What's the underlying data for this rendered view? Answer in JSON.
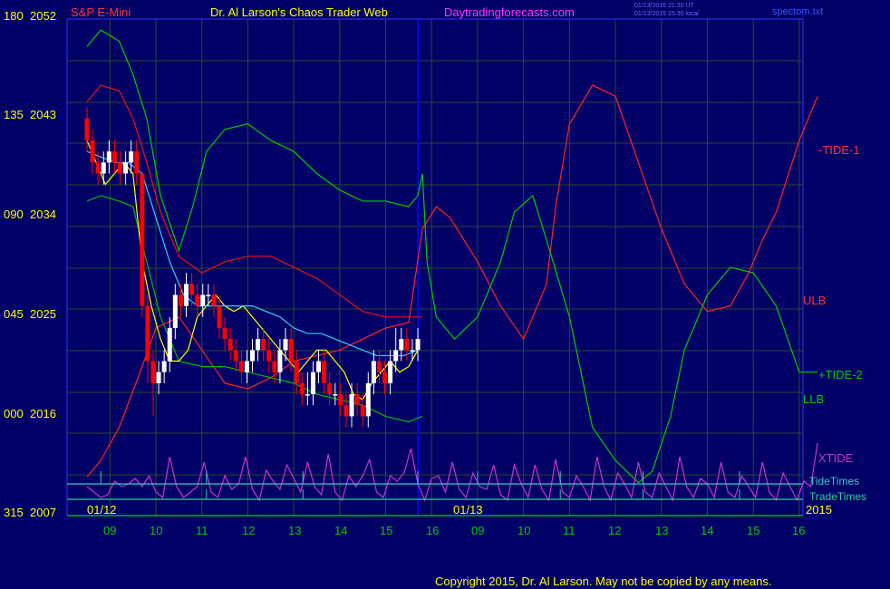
{
  "header": {
    "symbol": "S&P E-Mini",
    "title": "Dr. Al Larson's Chaos Trader Web",
    "site": "Daytradingforecasts.com",
    "timestamp_1": "01/13/2015 21:30 UT",
    "timestamp_2": "01/13/2015 15:30 local",
    "file": "spectom.txt"
  },
  "footer": {
    "copyright": "Copyright 2015, Dr. Al Larson. May not be copied by any means."
  },
  "colors": {
    "background": "#000066",
    "grid": "#2a4a2a",
    "vline": "#0000ff",
    "tide1": "#ff0000",
    "ulb": "#ff0000",
    "tide2": "#00cc00",
    "llb": "#00cc00",
    "xtide": "#cc33cc",
    "tidetimes": "#33cccc",
    "tradetimes": "#33cc99",
    "price_up": "#ffffff",
    "price_down": "#ff0000",
    "ma_fast": "#ffff00",
    "ma_slow": "#33ccff",
    "axis_text": "#ffff00",
    "time_text": "#00cc00"
  },
  "chart_data": {
    "type": "line",
    "y_axis": {
      "left_labels": [
        "180",
        "135",
        "090",
        "045",
        "000",
        "315"
      ],
      "right_labels": [
        "2052",
        "2043",
        "2034",
        "2025",
        "2016",
        "2007"
      ],
      "ylim": [
        2007,
        2052
      ]
    },
    "x_axis": {
      "hours": [
        "09",
        "10",
        "11",
        "12",
        "13",
        "14",
        "15",
        "16",
        "09",
        "10",
        "11",
        "12",
        "13",
        "14",
        "15",
        "16"
      ],
      "dates": [
        "01/12",
        "01/13"
      ],
      "year": "2015"
    },
    "legend": [
      {
        "name": "-TIDE-1",
        "color": "#ff3333"
      },
      {
        "name": "ULB",
        "color": "#ff3333"
      },
      {
        "name": "+TIDE-2",
        "color": "#00cc00"
      },
      {
        "name": "LLB",
        "color": "#00cc00"
      },
      {
        "name": "XTIDE",
        "color": "#cc33cc"
      },
      {
        "name": "TideTimes",
        "color": "#33cccc"
      },
      {
        "name": "TradeTimes",
        "color": "#33cc99"
      }
    ],
    "series": [
      {
        "key": "tide1",
        "x": [
          0,
          0.3,
          0.7,
          1.2,
          1.5,
          2,
          2.5,
          3,
          3.5,
          4,
          4.5,
          5,
          5.5,
          6,
          6.5,
          7,
          7.3,
          7.6,
          7.9,
          8.2,
          8.5,
          9,
          9.5,
          10,
          10.2,
          10.5,
          11,
          11.5,
          12,
          12.5,
          13,
          13.5,
          14,
          14.4,
          14.7,
          15,
          15.5,
          15.9
        ],
        "values": [
          2010.5,
          2012,
          2015,
          2020.5,
          2024,
          2025,
          2022,
          2019,
          2018.5,
          2019.5,
          2021,
          2021.5,
          2022,
          2023,
          2024,
          2024.5,
          2033,
          2035,
          2034,
          2032,
          2030,
          2026,
          2023,
          2028,
          2035,
          2042.5,
          2046,
          2045,
          2039,
          2033,
          2028,
          2025.5,
          2026,
          2029,
          2032,
          2034.5,
          2041,
          2045
        ]
      },
      {
        "key": "ulb",
        "x": [
          0,
          0.3,
          0.7,
          1,
          1.3,
          1.6,
          2,
          2.5,
          3,
          3.5,
          4,
          4.5,
          5,
          5.5,
          6,
          6.5,
          7,
          7.3
        ],
        "values": [
          2044.5,
          2046,
          2045.5,
          2043,
          2039,
          2034.5,
          2030.5,
          2029,
          2030,
          2030.5,
          2030.5,
          2029.5,
          2028.5,
          2027,
          2025.5,
          2025,
          2025,
          2025
        ]
      },
      {
        "key": "tide2",
        "x": [
          0,
          0.3,
          0.7,
          1,
          1.3,
          1.6,
          2,
          2.3,
          2.6,
          3,
          3.5,
          4,
          4.5,
          5,
          5.5,
          6,
          6.5,
          7,
          7.2,
          7.3,
          7.4,
          7.6,
          8,
          8.5,
          9,
          9.3,
          9.7,
          10,
          10.5,
          11,
          11.5,
          12,
          12.3,
          12.7,
          13,
          13.5,
          14,
          14.5,
          15,
          15.5,
          15.9
        ],
        "values": [
          2049.5,
          2051,
          2050,
          2047,
          2043,
          2036,
          2031,
          2035,
          2040,
          2042,
          2042.5,
          2041,
          2040,
          2038,
          2036.5,
          2035.5,
          2035.5,
          2035,
          2036,
          2038,
          2030,
          2025,
          2023,
          2025,
          2030,
          2034.5,
          2036,
          2032,
          2025,
          2015,
          2012,
          2010,
          2011,
          2016,
          2022,
          2027,
          2029.5,
          2029,
          2026,
          2020,
          2020
        ]
      },
      {
        "key": "llb",
        "x": [
          0,
          0.3,
          0.7,
          1,
          1.3,
          1.6,
          2,
          2.5,
          3,
          3.5,
          4,
          4.5,
          5,
          5.5,
          6,
          6.5,
          7,
          7.3
        ],
        "values": [
          2035.5,
          2036,
          2035.5,
          2035,
          2030,
          2025,
          2021,
          2020.5,
          2020.5,
          2020,
          2019.5,
          2019,
          2018,
          2017.5,
          2017,
          2016,
          2015.5,
          2016
        ]
      },
      {
        "key": "ma_fast",
        "x": [
          0,
          0.2,
          0.4,
          0.6,
          0.8,
          1,
          1.2,
          1.4,
          1.6,
          1.8,
          2,
          2.2,
          2.4,
          2.6,
          2.8,
          3,
          3.2,
          3.4,
          3.6,
          3.8,
          4,
          4.2,
          4.4,
          4.6,
          4.8,
          5,
          5.2,
          5.4,
          5.6,
          5.8,
          6,
          6.2,
          6.4,
          6.6,
          6.8,
          7,
          7.2
        ],
        "values": [
          2041,
          2039,
          2037,
          2038,
          2039,
          2038,
          2030,
          2026,
          2023,
          2021,
          2021,
          2022,
          2025,
          2026,
          2027,
          2026,
          2025.5,
          2026,
          2025,
          2024,
          2023,
          2022,
          2021,
          2020,
          2021,
          2022,
          2022,
          2021,
          2020,
          2018,
          2017.5,
          2019,
          2020,
          2021,
          2020,
          2020.5,
          2022
        ]
      },
      {
        "key": "ma_slow",
        "x": [
          0,
          0.3,
          0.6,
          0.9,
          1.2,
          1.5,
          1.8,
          2.1,
          2.4,
          2.7,
          3,
          3.3,
          3.6,
          3.9,
          4.2,
          4.5,
          4.8,
          5.1,
          5.4,
          5.7,
          6,
          6.3,
          6.6,
          6.9,
          7.2
        ],
        "values": [
          2040,
          2039.5,
          2039,
          2039,
          2038,
          2034,
          2030,
          2027,
          2026,
          2026,
          2026,
          2026,
          2026,
          2025.5,
          2025,
          2024,
          2023.5,
          2023.5,
          2023,
          2022.5,
          2022,
          2021.5,
          2021.5,
          2021.5,
          2022
        ]
      },
      {
        "key": "xtide",
        "x": [
          0,
          0.15,
          0.3,
          0.45,
          0.6,
          0.75,
          0.9,
          1.05,
          1.2,
          1.35,
          1.5,
          1.65,
          1.8,
          1.95,
          2.1,
          2.25,
          2.4,
          2.55,
          2.7,
          2.85,
          3,
          3.15,
          3.3,
          3.45,
          3.6,
          3.75,
          3.9,
          4.05,
          4.2,
          4.35,
          4.5,
          4.65,
          4.8,
          4.95,
          5.1,
          5.25,
          5.4,
          5.55,
          5.7,
          5.85,
          6,
          6.15,
          6.3,
          6.45,
          6.6,
          6.75,
          6.9,
          7.05,
          7.2,
          7.35,
          7.5,
          7.65,
          7.8,
          7.95,
          8.1,
          8.25,
          8.4,
          8.55,
          8.7,
          8.85,
          9,
          9.15,
          9.3,
          9.45,
          9.6,
          9.75,
          9.9,
          10.05,
          10.2,
          10.35,
          10.5,
          10.65,
          10.8,
          10.95,
          11.1,
          11.25,
          11.4,
          11.55,
          11.7,
          11.85,
          12,
          12.15,
          12.3,
          12.45,
          12.6,
          12.75,
          12.9,
          13.05,
          13.2,
          13.35,
          13.5,
          13.65,
          13.8,
          13.95,
          14.1,
          14.25,
          14.4,
          14.55,
          14.7,
          14.85,
          15,
          15.15,
          15.3,
          15.45,
          15.6,
          15.75,
          15.9
        ],
        "values": [
          0.3,
          0.2,
          0.1,
          0.15,
          0.4,
          0.3,
          0.35,
          0.45,
          0.3,
          0.5,
          0.2,
          0.1,
          0.85,
          0.3,
          0.1,
          0.2,
          0.3,
          0.75,
          0.2,
          0.1,
          0.5,
          0.25,
          0.35,
          0.85,
          0.25,
          0.05,
          0.6,
          0.4,
          0.25,
          0.7,
          0.45,
          0.2,
          0.75,
          0.3,
          0.15,
          0.9,
          0.2,
          0.05,
          0.5,
          0.3,
          0.5,
          0.8,
          0.2,
          0.1,
          0.5,
          0.4,
          0.55,
          1,
          0.35,
          0.05,
          0.45,
          0.5,
          0.2,
          0.75,
          0.25,
          0.1,
          0.55,
          0.3,
          0.25,
          0.7,
          0.15,
          0.05,
          0.7,
          0.35,
          0.1,
          0.7,
          0.25,
          0.05,
          0.8,
          0.2,
          0.1,
          0.5,
          0.3,
          0.05,
          0.85,
          0.3,
          0.05,
          0.55,
          0.35,
          0.1,
          0.75,
          0.2,
          0.1,
          0.55,
          0.3,
          0.05,
          0.85,
          0.3,
          0.1,
          0.45,
          0.35,
          0.1,
          0.75,
          0.2,
          0.1,
          0.5,
          0.3,
          0.1,
          0.75,
          0.2,
          0.05,
          0.55,
          0.3,
          0.05,
          0.4,
          0.3,
          1.1
        ]
      }
    ],
    "price": {
      "x": [
        0,
        0.12,
        0.24,
        0.36,
        0.48,
        0.6,
        0.72,
        0.84,
        0.96,
        1.08,
        1.2,
        1.32,
        1.44,
        1.56,
        1.68,
        1.8,
        1.92,
        2.04,
        2.16,
        2.28,
        2.4,
        2.52,
        2.64,
        2.76,
        2.88,
        3,
        3.12,
        3.24,
        3.36,
        3.48,
        3.6,
        3.72,
        3.84,
        3.96,
        4.08,
        4.2,
        4.32,
        4.44,
        4.56,
        4.68,
        4.8,
        4.92,
        5.04,
        5.16,
        5.28,
        5.4,
        5.52,
        5.64,
        5.76,
        5.88,
        6,
        6.12,
        6.24,
        6.36,
        6.48,
        6.6,
        6.72,
        6.84,
        6.96,
        7.08,
        7.2
      ],
      "open": [
        2043,
        2041,
        2039,
        2038,
        2039,
        2040,
        2039,
        2038,
        2039,
        2040,
        2038,
        2026,
        2021,
        2019,
        2020,
        2021,
        2024,
        2027,
        2026,
        2028,
        2027,
        2026,
        2027,
        2027,
        2026,
        2024,
        2023,
        2022,
        2021,
        2020,
        2021,
        2022,
        2023,
        2022,
        2021,
        2020,
        2022,
        2023,
        2021,
        2019,
        2018,
        2018,
        2020,
        2021,
        2019,
        2018,
        2018,
        2017,
        2016,
        2018,
        2017,
        2016,
        2019,
        2021,
        2020,
        2019,
        2021,
        2022,
        2023,
        2022,
        2022
      ],
      "close": [
        2041,
        2039,
        2038,
        2039,
        2040,
        2039,
        2038,
        2039,
        2040,
        2038,
        2026,
        2021,
        2019,
        2020,
        2021,
        2024,
        2027,
        2026,
        2028,
        2027,
        2026,
        2027,
        2027,
        2026,
        2024,
        2023,
        2022,
        2021,
        2020,
        2021,
        2022,
        2023,
        2022,
        2021,
        2020,
        2022,
        2023,
        2021,
        2019,
        2018,
        2018,
        2020,
        2021,
        2019,
        2018,
        2018,
        2017,
        2016,
        2018,
        2017,
        2016,
        2019,
        2021,
        2020,
        2019,
        2021,
        2022,
        2023,
        2022,
        2022,
        2023
      ],
      "high": [
        2044,
        2042,
        2040,
        2040,
        2041,
        2041,
        2040,
        2040,
        2041,
        2041,
        2038,
        2027,
        2022,
        2021,
        2022,
        2025,
        2028,
        2028,
        2029,
        2029,
        2028,
        2028,
        2028,
        2028,
        2027,
        2025,
        2024,
        2023,
        2022,
        2022,
        2023,
        2024,
        2024,
        2023,
        2022,
        2023,
        2024,
        2024,
        2022,
        2020,
        2020,
        2021,
        2022,
        2022,
        2020,
        2019,
        2019,
        2018,
        2019,
        2019,
        2018,
        2020,
        2022,
        2022,
        2021,
        2022,
        2024,
        2024,
        2024,
        2023,
        2024
      ],
      "low": [
        2040,
        2038,
        2037,
        2037,
        2038,
        2038,
        2037,
        2037,
        2038,
        2037,
        2025,
        2019,
        2016,
        2018,
        2019,
        2020,
        2023,
        2025,
        2025,
        2026,
        2025,
        2025,
        2026,
        2025,
        2023,
        2022,
        2021,
        2020,
        2019,
        2019,
        2020,
        2021,
        2021,
        2020,
        2019,
        2019,
        2021,
        2020,
        2018,
        2017,
        2017,
        2017,
        2019,
        2018,
        2017,
        2017,
        2016,
        2015,
        2015,
        2016,
        2015,
        2015,
        2018,
        2019,
        2018,
        2018,
        2020,
        2021,
        2021,
        2021,
        2021
      ]
    }
  }
}
